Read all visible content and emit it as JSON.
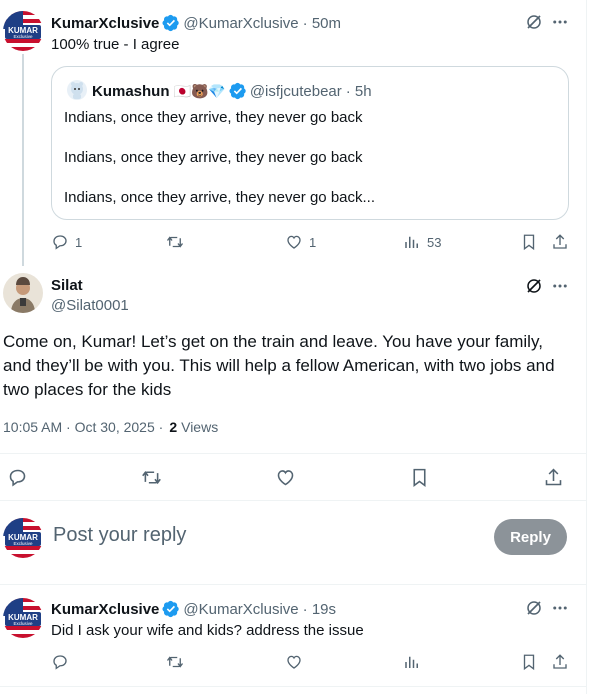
{
  "colors": {
    "verified": "#1d9bf0",
    "muted": "#536471",
    "reply_button_bg": "#8c9399"
  },
  "tweet1": {
    "name": "KumarXclusive",
    "handle": "@KumarXclusive",
    "time": "· 50m",
    "text": "100% true - I agree",
    "avatar_text_top": "KUMAR",
    "avatar_text_bottom": "Exclusive",
    "quote": {
      "name": "Kumashun",
      "emojis": "🇯🇵🐻💎",
      "handle": "@isfjcutebear",
      "time": "· 5h",
      "lines": [
        "Indians, once they arrive, they never go back",
        "Indians, once they arrive, they never go back",
        "Indians, once they arrive, they never go back..."
      ]
    },
    "actions": {
      "replies": "1",
      "likes": "1",
      "views": "53"
    }
  },
  "main_tweet": {
    "name": "Silat",
    "handle": "@Silat0001",
    "text": "Come on, Kumar! Let’s get on the train and leave. You have your family, and they’ll be with you. This will help a fellow American, with two jobs and two places for the kids",
    "timestamp": "10:05 AM · Oct 30, 2025 ·",
    "views_count": "2",
    "views_label": "Views"
  },
  "reply_box": {
    "placeholder": "Post your reply",
    "button": "Reply"
  },
  "tweet3": {
    "name": "KumarXclusive",
    "handle": "@KumarXclusive",
    "time": "· 19s",
    "text": "Did I ask your wife and kids? address the issue"
  },
  "icons": [
    "reply-icon",
    "retweet-icon",
    "like-icon",
    "views-icon",
    "bookmark-icon",
    "share-icon",
    "grok-icon",
    "more-icon",
    "verified-icon"
  ]
}
